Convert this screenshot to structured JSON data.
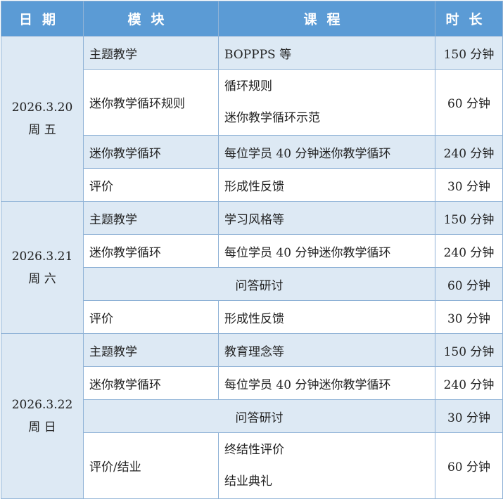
{
  "header": {
    "date": "日期",
    "module": "模块",
    "course": "课程",
    "duration": "时长"
  },
  "days": [
    {
      "date": "2026.3.20",
      "weekday": "周 五",
      "rows": [
        {
          "module": "主题教学",
          "course": [
            "BOPPPS 等"
          ],
          "duration": "150 分钟"
        },
        {
          "module": "迷你教学循环规则",
          "course": [
            "循环规则",
            "迷你教学循环示范"
          ],
          "duration": "60 分钟"
        },
        {
          "module": "迷你教学循环",
          "course": [
            "每位学员 40 分钟迷你教学循环"
          ],
          "duration": "240 分钟"
        },
        {
          "module": "评价",
          "course": [
            "形成性反馈"
          ],
          "duration": "30 分钟"
        }
      ]
    },
    {
      "date": "2026.3.21",
      "weekday": "周 六",
      "rows": [
        {
          "module": "主题教学",
          "course": [
            "学习风格等"
          ],
          "duration": "150 分钟"
        },
        {
          "module": "迷你教学循环",
          "course": [
            "每位学员 40 分钟迷你教学循环"
          ],
          "duration": "240 分钟"
        },
        {
          "merged": "问答研讨",
          "duration": "60 分钟"
        },
        {
          "module": "评价",
          "course": [
            "形成性反馈"
          ],
          "duration": "30 分钟"
        }
      ]
    },
    {
      "date": "2026.3.22",
      "weekday": "周 日",
      "rows": [
        {
          "module": "主题教学",
          "course": [
            "教育理念等"
          ],
          "duration": "150 分钟"
        },
        {
          "module": "迷你教学循环",
          "course": [
            "每位学员 40 分钟迷你教学循环"
          ],
          "duration": "240 分钟"
        },
        {
          "merged": "问答研讨",
          "duration": "30 分钟"
        },
        {
          "module": "评价/结业",
          "course": [
            "终结性评价",
            "结业典礼"
          ],
          "duration": "60 分钟"
        }
      ]
    }
  ]
}
